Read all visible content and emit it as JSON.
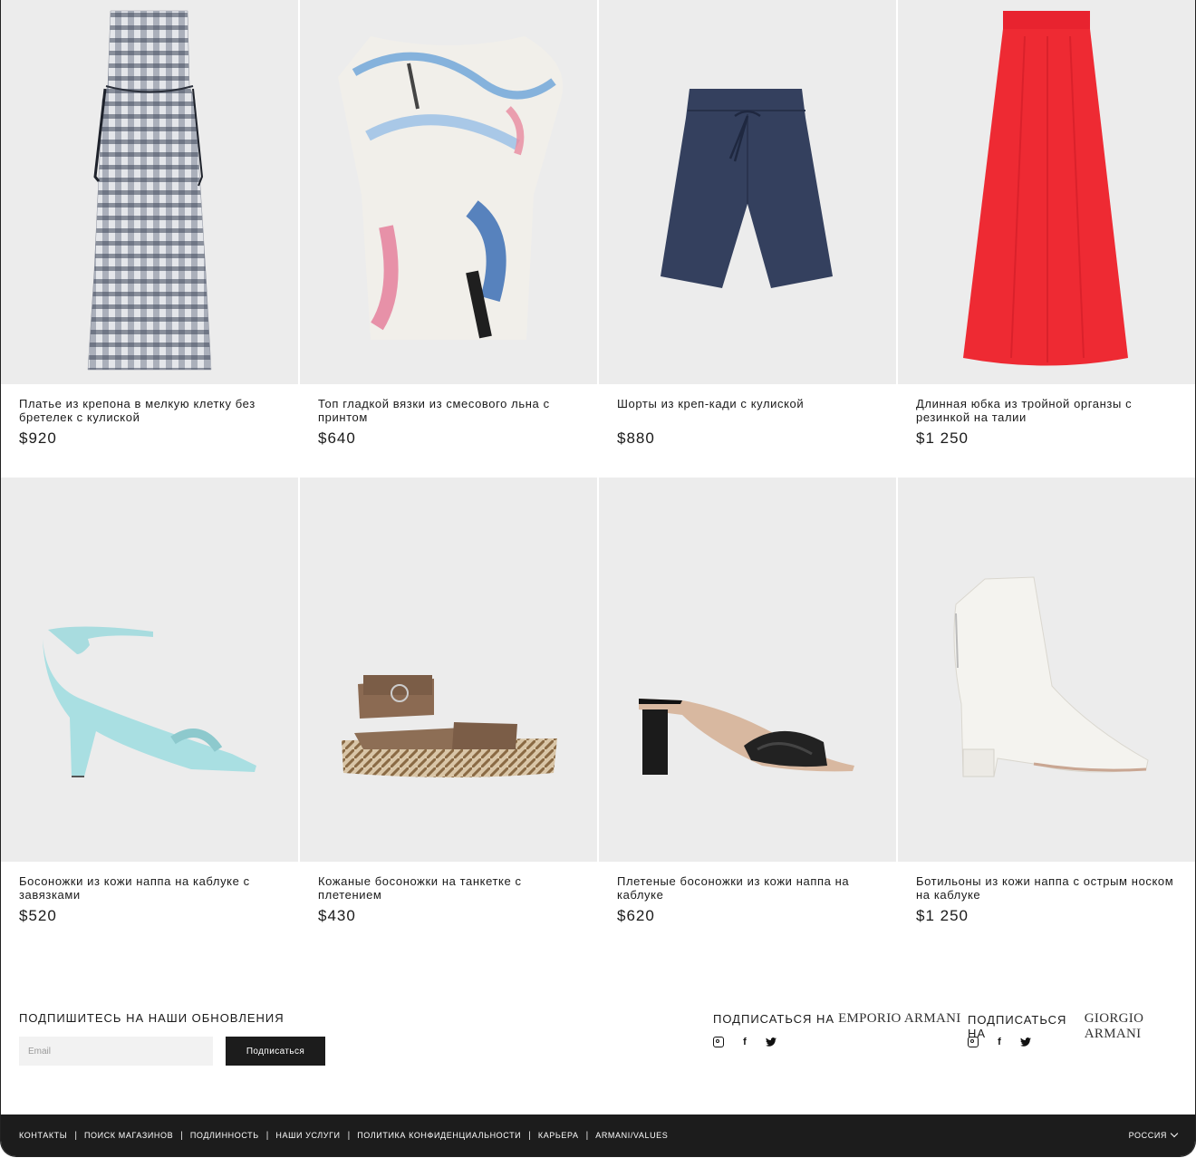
{
  "products": [
    {
      "title": "Платье из крепона в мелкую клетку без бретелек с кулиской",
      "price": "$920",
      "image_icon": "checked-dress-icon"
    },
    {
      "title": "Топ гладкой вязки из смесового льна с принтом",
      "price": "$640",
      "image_icon": "printed-top-icon"
    },
    {
      "title": "Шорты из креп-кади с кулиской",
      "price": "$880",
      "image_icon": "navy-shorts-icon"
    },
    {
      "title": "Длинная юбка из тройной органзы с резинкой на талии",
      "price": "$1 250",
      "image_icon": "red-skirt-icon"
    },
    {
      "title": "Босоножки из кожи наппа на каблуке с завязками",
      "price": "$520",
      "image_icon": "blue-sandal-icon"
    },
    {
      "title": "Кожаные босоножки на танкетке с плетением",
      "price": "$430",
      "image_icon": "wedge-sandal-icon"
    },
    {
      "title": "Плетеные босоножки из кожи наппа на каблуке",
      "price": "$620",
      "image_icon": "black-mule-icon"
    },
    {
      "title": "Ботильоны из кожи наппа с острым носком на каблуке",
      "price": "$1 250",
      "image_icon": "white-bootie-icon"
    }
  ],
  "newsletter": {
    "title": "ПОДПИШИТЕСЬ НА НАШИ ОБНОВЛЕНИЯ",
    "email_placeholder": "Email",
    "button_label": "Подписаться"
  },
  "follow": [
    {
      "label": "ПОДПИСАТЬСЯ НА",
      "brand": "EMPORIO ARMANI",
      "icons": [
        "instagram-icon",
        "facebook-icon",
        "twitter-icon"
      ]
    },
    {
      "label": "ПОДПИСАТЬСЯ НА",
      "brand": "GIORGIO ARMANI",
      "icons": [
        "instagram-icon",
        "facebook-icon",
        "twitter-icon"
      ]
    }
  ],
  "footer": {
    "links": [
      "КОНТАКТЫ",
      "ПОИСК МАГАЗИНОВ",
      "ПОДЛИННОСТЬ",
      "НАШИ УСЛУГИ",
      "ПОЛИТИКА КОНФИДЕНЦИАЛЬНОСТИ",
      "КАРЬЕРА",
      "ARMANI/VALUES"
    ],
    "country": "РОССИЯ"
  },
  "colors": {
    "card_bg": "#ececec",
    "footer_bg": "#1c1c1c",
    "button_bg": "#1c1c1c"
  }
}
